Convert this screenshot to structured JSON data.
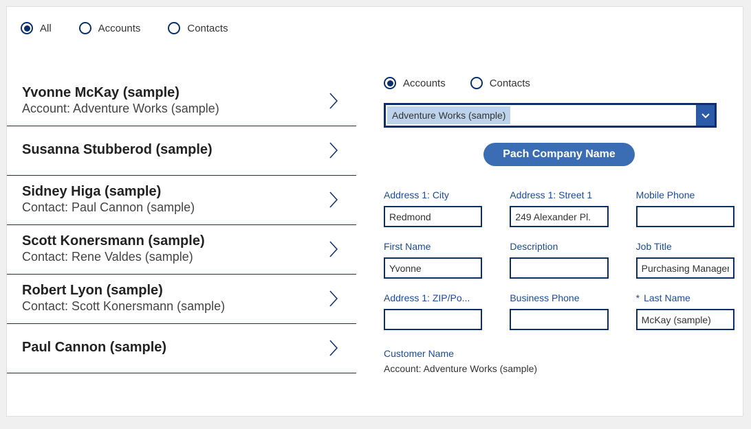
{
  "topFilter": {
    "selected": 0,
    "options": [
      "All",
      "Accounts",
      "Contacts"
    ]
  },
  "listItems": [
    {
      "title": "Yvonne McKay (sample)",
      "subtitle": "Account: Adventure Works (sample)"
    },
    {
      "title": "Susanna Stubberod (sample)",
      "subtitle": ""
    },
    {
      "title": "Sidney Higa (sample)",
      "subtitle": "Contact: Paul Cannon (sample)"
    },
    {
      "title": "Scott Konersmann (sample)",
      "subtitle": "Contact: Rene Valdes (sample)"
    },
    {
      "title": "Robert Lyon (sample)",
      "subtitle": "Contact: Scott Konersmann (sample)"
    },
    {
      "title": "Paul Cannon (sample)",
      "subtitle": ""
    }
  ],
  "rightFilter": {
    "selected": 0,
    "options": [
      "Accounts",
      "Contacts"
    ]
  },
  "dropdown": {
    "value": "Adventure Works (sample)"
  },
  "primaryButton": "Pach Company Name",
  "formFields": [
    {
      "label": "Address 1: City",
      "value": "Redmond",
      "required": false
    },
    {
      "label": "Address 1: Street 1",
      "value": "249 Alexander Pl.",
      "required": false
    },
    {
      "label": "Mobile Phone",
      "value": "",
      "required": false
    },
    {
      "label": "First Name",
      "value": "Yvonne",
      "required": false
    },
    {
      "label": "Description",
      "value": "",
      "required": false
    },
    {
      "label": "Job Title",
      "value": "Purchasing Manager",
      "required": false
    },
    {
      "label": "Address 1: ZIP/Po...",
      "value": "",
      "required": false
    },
    {
      "label": "Business Phone",
      "value": "",
      "required": false
    },
    {
      "label": "Last Name",
      "value": "McKay (sample)",
      "required": true
    }
  ],
  "customerName": {
    "label": "Customer Name",
    "value": "Account: Adventure Works (sample)"
  }
}
